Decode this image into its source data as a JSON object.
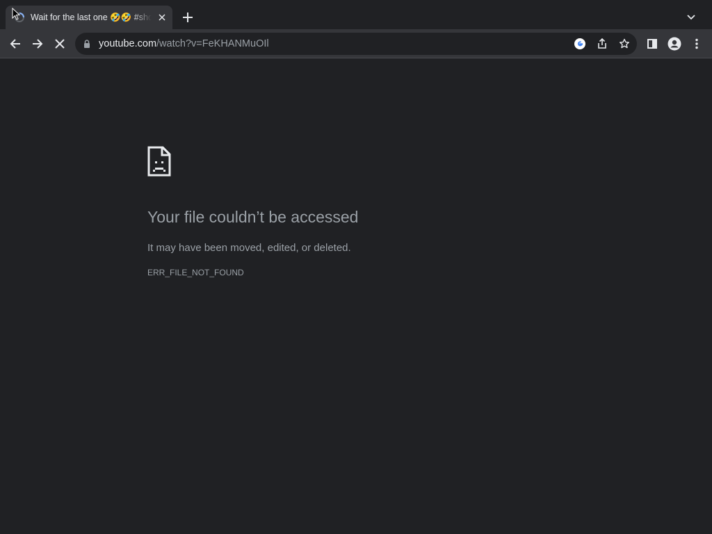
{
  "tab": {
    "title": "Wait for the last one 🤣🤣 #shorts",
    "favicon": "loading-spinner-icon"
  },
  "toolbar": {
    "url_host": "youtube.com",
    "url_path": "/watch?v=FeKHANMuOIl",
    "icons": [
      "back-arrow-icon",
      "forward-arrow-icon",
      "stop-loading-icon",
      "lock-icon",
      "google-icon",
      "share-icon",
      "bookmark-star-icon",
      "side-panel-icon",
      "profile-icon",
      "more-menu-icon"
    ]
  },
  "error_page": {
    "icon": "sad-file-icon",
    "heading": "Your file couldn’t be accessed",
    "message": "It may have been moved, edited, or deleted.",
    "code": "ERR_FILE_NOT_FOUND"
  },
  "colors": {
    "page_bg": "#202124",
    "toolbar_bg": "#35363a",
    "text_primary": "#e8eaed",
    "text_secondary": "#9aa0a6"
  }
}
